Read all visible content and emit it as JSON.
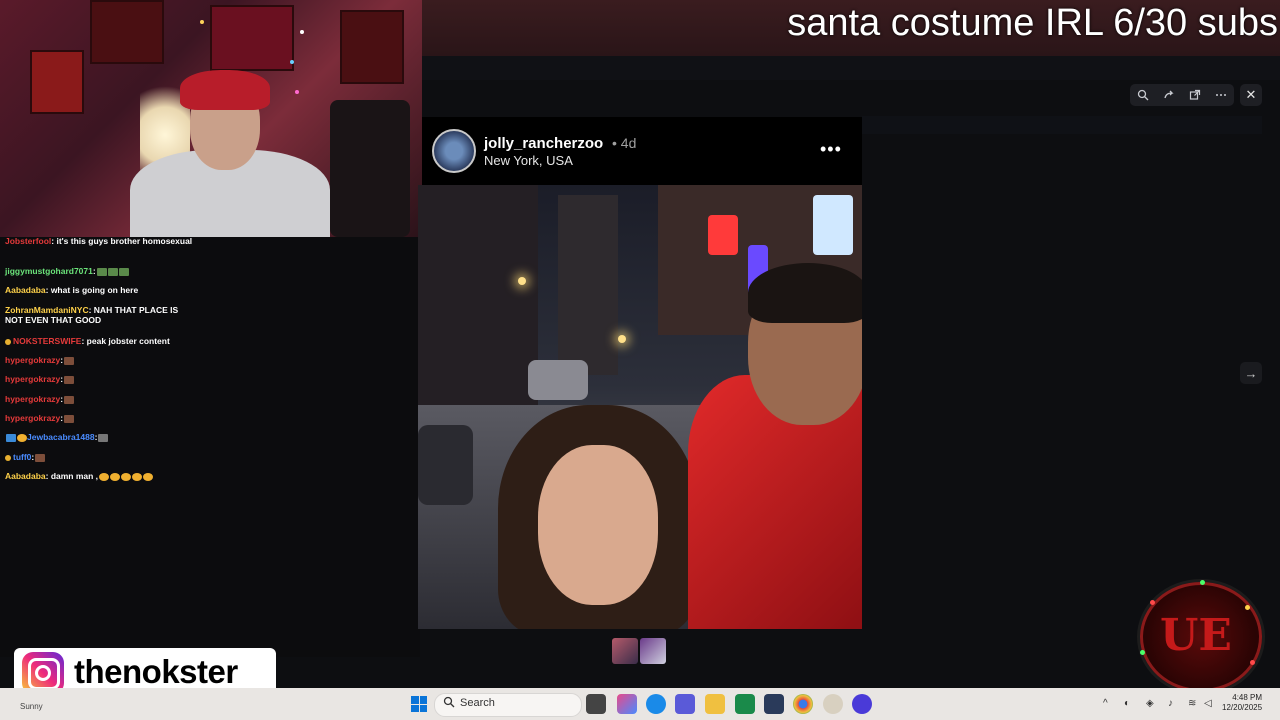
{
  "stream": {
    "title": "santa costume IRL 6/30 subs"
  },
  "post": {
    "username": "jolly_rancherzoo",
    "age": "• 4d",
    "location": "New York, USA",
    "more": "•••"
  },
  "viewer": {
    "zoom_icon": "zoom-in-icon",
    "share_icon": "share-icon",
    "open_icon": "open-external-icon",
    "more_icon": "more-horizontal-icon",
    "close": "✕",
    "next": "→"
  },
  "chat": [
    {
      "user": "Jobsterfool",
      "color": "#e53a3a",
      "message": ": it's this guys brother homosexual"
    },
    {
      "user": "jiggymustgohard7071",
      "color": "#6be37a",
      "message": ":"
    },
    {
      "user": "Aabadaba",
      "color": "#ffd24a",
      "message": ": what is going on here"
    },
    {
      "user": "ZohranMamdaniNYC",
      "color": "#ffd24a",
      "message": ": NAH THAT PLACE IS NOT EVEN THAT GOOD"
    },
    {
      "user": "NOKSTERSWIFE",
      "color": "#e53a3a",
      "message": ": peak jobster content"
    },
    {
      "user": "hypergokrazy",
      "color": "#e53a3a",
      "message": ":"
    },
    {
      "user": "hypergokrazy",
      "color": "#e53a3a",
      "message": ":"
    },
    {
      "user": "hypergokrazy",
      "color": "#e53a3a",
      "message": ":"
    },
    {
      "user": "hypergokrazy",
      "color": "#e53a3a",
      "message": ":"
    },
    {
      "user": "Jewbacabra1488",
      "color": "#4a8cff",
      "message": ":"
    },
    {
      "user": "tuff0",
      "color": "#4a8cff",
      "message": ":"
    },
    {
      "user": "Aabadaba",
      "color": "#ffd24a",
      "message": ": damn man ,"
    }
  ],
  "instagram": {
    "handle": "thenokster",
    "icon": "instagram-icon"
  },
  "taskbar": {
    "search_placeholder": "Search",
    "time": "4:48 PM",
    "date": "12/20/2025",
    "weather": "Sunny"
  },
  "colors": {
    "accent_red": "#c51a1a",
    "instagram_gradient_start": "#f9ce34",
    "instagram_gradient_mid": "#ee2a7b",
    "instagram_gradient_end": "#6228d7"
  }
}
